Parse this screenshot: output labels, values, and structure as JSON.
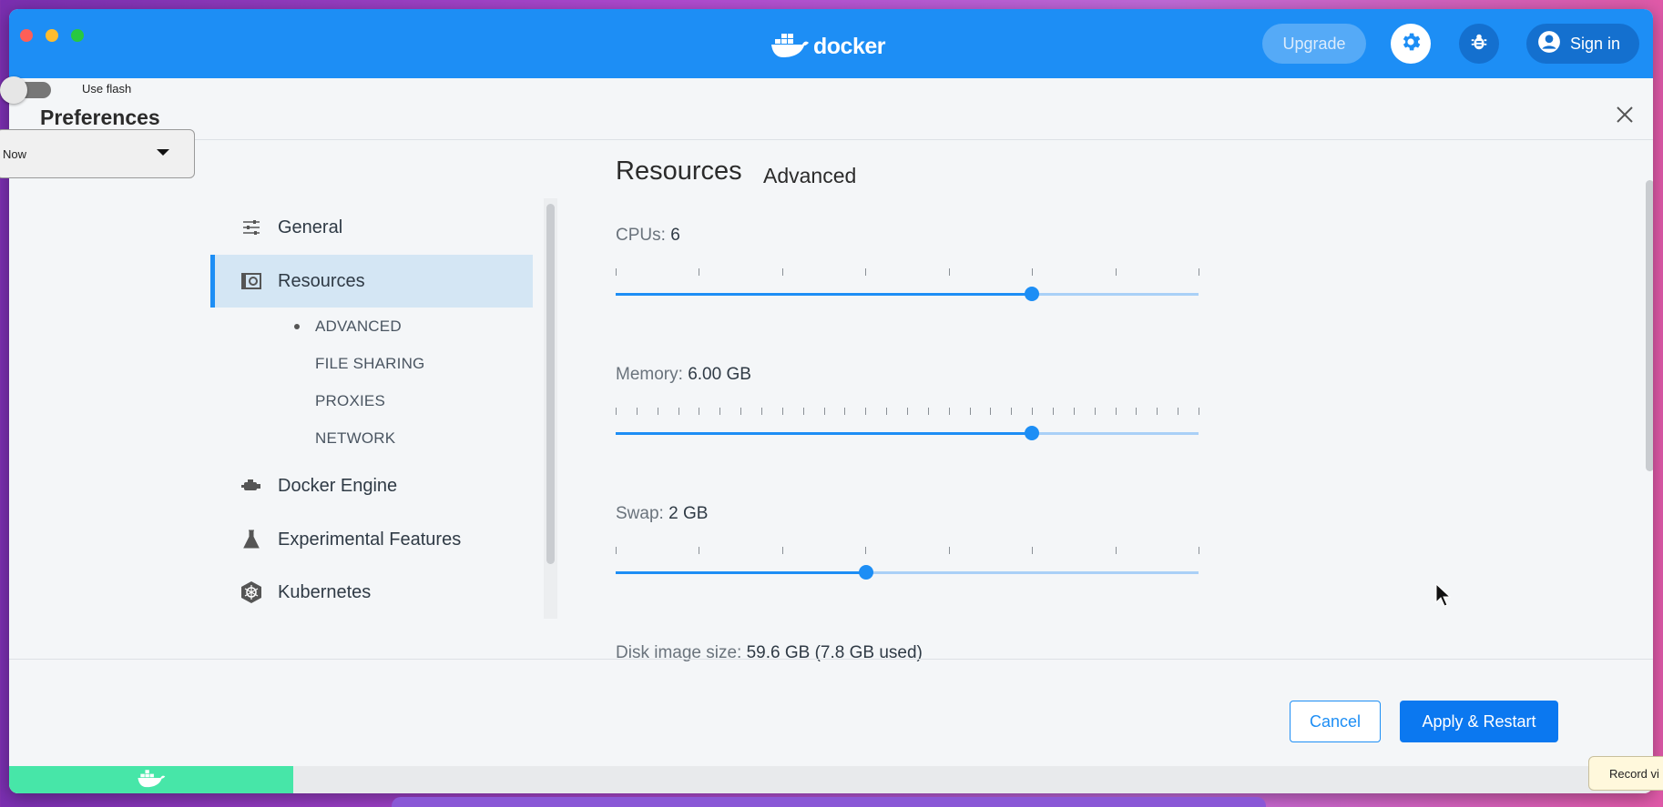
{
  "app": {
    "logo_text": "docker",
    "upgrade_label": "Upgrade",
    "signin_label": "Sign in"
  },
  "preferences": {
    "title": "Preferences"
  },
  "sidebar": {
    "items": [
      {
        "label": "General",
        "icon": "sliders-icon"
      },
      {
        "label": "Resources",
        "icon": "resources-icon",
        "active": true
      },
      {
        "label": "Docker Engine",
        "icon": "engine-icon"
      },
      {
        "label": "Experimental Features",
        "icon": "flask-icon"
      },
      {
        "label": "Kubernetes",
        "icon": "helm-icon"
      }
    ],
    "subitems": [
      {
        "label": "ADVANCED",
        "active": true
      },
      {
        "label": "FILE SHARING"
      },
      {
        "label": "PROXIES"
      },
      {
        "label": "NETWORK"
      }
    ]
  },
  "content": {
    "heading": "Resources",
    "subheading": "Advanced",
    "cpus": {
      "label": "CPUs:",
      "value": "6",
      "level": 0.714
    },
    "memory": {
      "label": "Memory:",
      "value": "6.00 GB",
      "level": 0.714
    },
    "swap": {
      "label": "Swap:",
      "value": "2 GB",
      "level": 0.429
    },
    "disk": {
      "label": "Disk image size:",
      "value": "59.6 GB (7.8 GB used)"
    }
  },
  "footer": {
    "cancel_label": "Cancel",
    "apply_label": "Apply & Restart"
  },
  "overlay": {
    "flash_label": "Use flash",
    "select_value": "Now",
    "record_tooltip": "Record vi"
  },
  "colors": {
    "accent": "#1d8ef5",
    "status_green": "#47e6a8"
  }
}
